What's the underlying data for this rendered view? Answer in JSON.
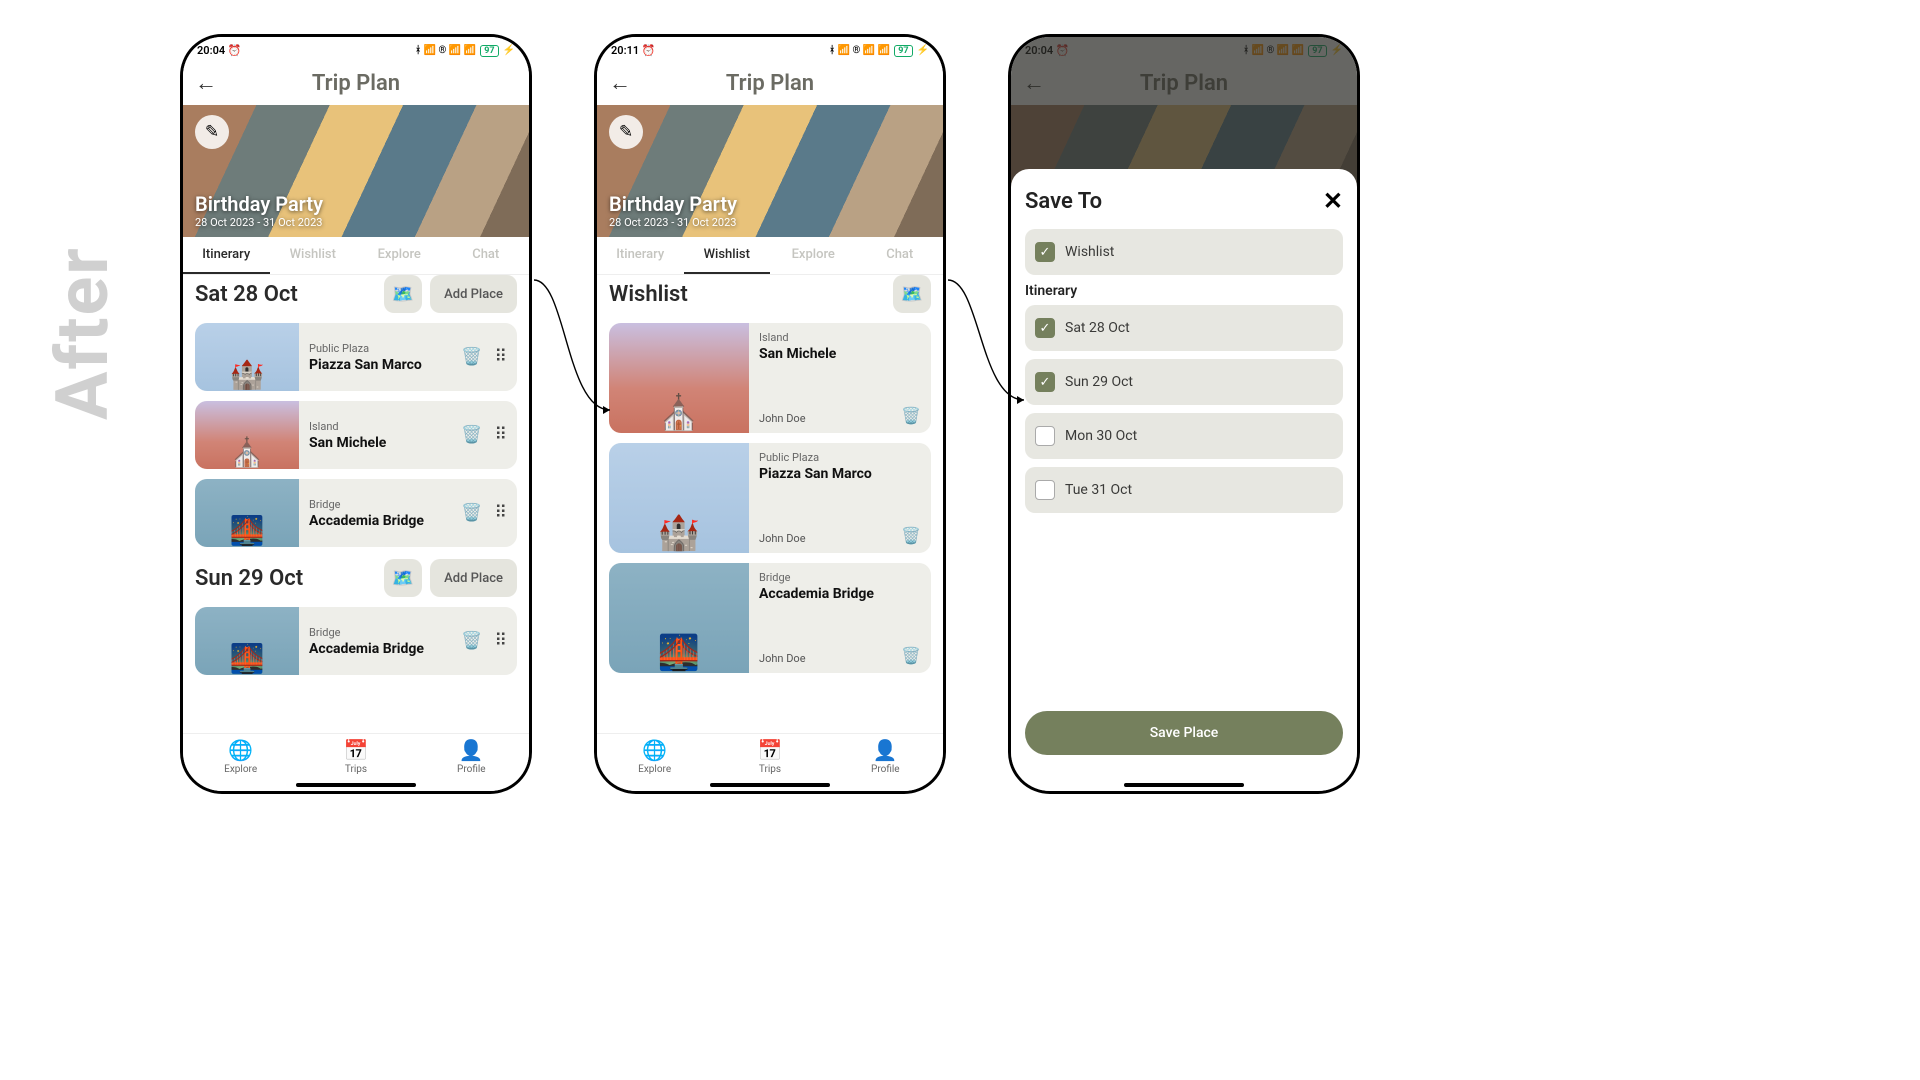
{
  "label": "After",
  "status": {
    "time_a": "20:04",
    "time_b": "20:11",
    "clock_icon": "⏰",
    "battery": "97"
  },
  "header": {
    "title": "Trip Plan"
  },
  "hero": {
    "name": "Birthday Party",
    "dates": "28 Oct 2023 - 31 Oct 2023"
  },
  "tabs": {
    "itinerary": "Itinerary",
    "wishlist": "Wishlist",
    "explore": "Explore",
    "chat": "Chat"
  },
  "buttons": {
    "add_place": "Add Place",
    "save_place": "Save Place"
  },
  "days": [
    {
      "label": "Sat 28 Oct",
      "items": [
        {
          "cat": "Public Plaza",
          "name": "Piazza San Marco",
          "thumb": "sky",
          "emoji": "🏰"
        },
        {
          "cat": "Island",
          "name": "San Michele",
          "thumb": "dusk",
          "emoji": "⛪"
        },
        {
          "cat": "Bridge",
          "name": "Accademia Bridge",
          "thumb": "water",
          "emoji": "🌉"
        }
      ]
    },
    {
      "label": "Sun 29 Oct",
      "items": [
        {
          "cat": "Bridge",
          "name": "Accademia Bridge",
          "thumb": "water",
          "emoji": "🌉"
        }
      ]
    }
  ],
  "wishlist": {
    "title": "Wishlist",
    "items": [
      {
        "cat": "Island",
        "name": "San Michele",
        "user": "John Doe",
        "thumb": "dusk",
        "emoji": "⛪"
      },
      {
        "cat": "Public Plaza",
        "name": "Piazza San Marco",
        "user": "John Doe",
        "thumb": "sky",
        "emoji": "🏰"
      },
      {
        "cat": "Bridge",
        "name": "Accademia Bridge",
        "user": "John Doe",
        "thumb": "water",
        "emoji": "🌉"
      }
    ]
  },
  "sheet": {
    "title": "Save To",
    "wishlist_label": "Wishlist",
    "section": "Itinerary",
    "days": [
      {
        "label": "Sat 28 Oct",
        "checked": true
      },
      {
        "label": "Sun 29 Oct",
        "checked": true
      },
      {
        "label": "Mon 30 Oct",
        "checked": false
      },
      {
        "label": "Tue 31 Oct",
        "checked": false
      }
    ]
  },
  "bottom": {
    "explore": "Explore",
    "trips": "Trips",
    "profile": "Profile"
  }
}
